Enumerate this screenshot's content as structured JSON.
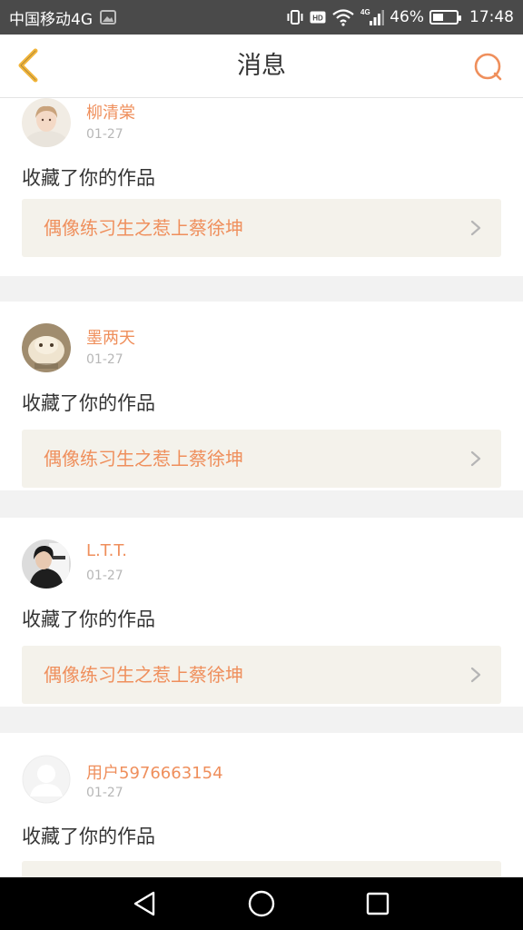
{
  "status_bar": {
    "carrier": "中国移动4G",
    "network_badge": "4G",
    "battery": "46%",
    "time": "17:48",
    "icons": [
      "image-icon",
      "vibrate-icon",
      "hd-icon",
      "wifi-icon",
      "signal-icon",
      "battery-icon"
    ]
  },
  "header": {
    "title": "消息",
    "back_icon": "chevron-left-icon",
    "search_icon": "search-icon"
  },
  "messages": [
    {
      "username": "柳清棠",
      "date": "01-27",
      "action": "收藏了你的作品",
      "work_title": "偶像练习生之惹上蔡徐坤"
    },
    {
      "username": "墨两天",
      "date": "01-27",
      "action": "收藏了你的作品",
      "work_title": "偶像练习生之惹上蔡徐坤"
    },
    {
      "username": "L.T.T.",
      "date": "01-27",
      "action": "收藏了你的作品",
      "work_title": "偶像练习生之惹上蔡徐坤"
    },
    {
      "username": "用户5976663154",
      "date": "01-27",
      "action": "收藏了你的作品",
      "work_title": ""
    }
  ],
  "system_nav": {
    "icons": [
      "back-triangle-icon",
      "home-circle-icon",
      "recents-square-icon"
    ]
  },
  "colors": {
    "accent": "#ef8f5c",
    "nav_icon": "#f2b53a",
    "work_bg": "#f4f2eb",
    "status_bar_bg": "#4a4a4a"
  }
}
